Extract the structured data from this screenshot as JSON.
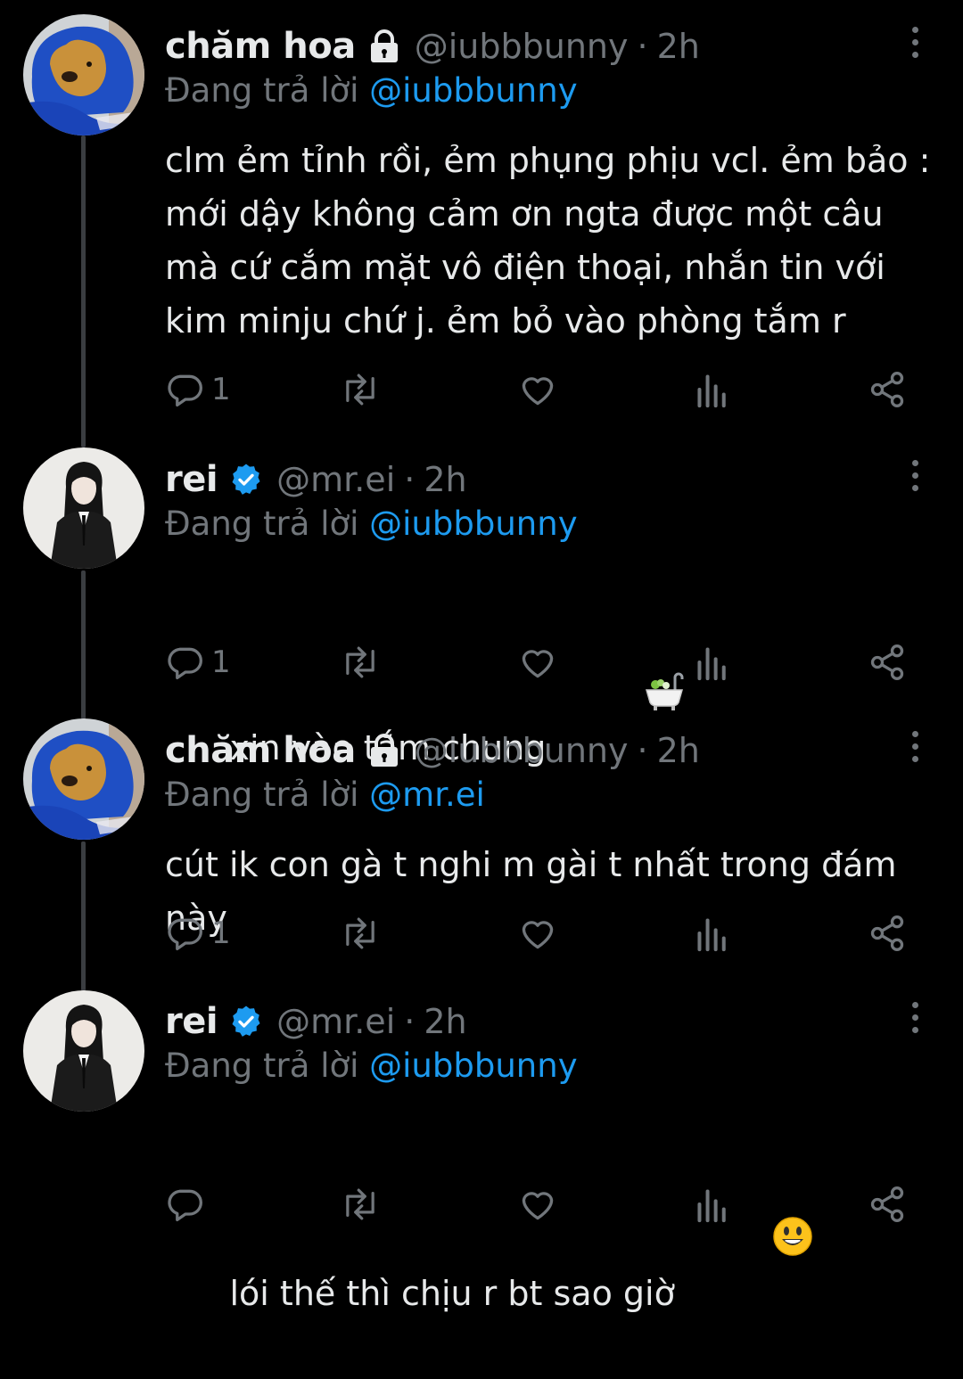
{
  "colors": {
    "background": "#000000",
    "text": "#e7e9ea",
    "muted": "#71767b",
    "accent": "#1d9bf0",
    "thread_line": "#3a3d41"
  },
  "tweets": [
    {
      "display_name": "chăm hoa",
      "badge": "lock-icon",
      "handle": "@iubbbunny",
      "separator": "·",
      "time": "2h",
      "reply_prefix": "Đang trả lời ",
      "reply_to": "@iubbbunny",
      "text": "clm ẻm tỉnh rồi, ẻm phụng phịu vcl. ẻm bảo : mới dậy không cảm ơn ngta được một câu mà cứ cắm mặt vô điện thoại, nhắn tin với kim minju chứ j. ẻm bỏ vào phòng tắm r",
      "emoji": "",
      "reply_count": "1",
      "avatar": "dog-in-blue-hoodie-avatar"
    },
    {
      "display_name": "rei",
      "badge": "verified-icon",
      "handle": "@mr.ei",
      "separator": "·",
      "time": "2h",
      "reply_prefix": "Đang trả lời ",
      "reply_to": "@iubbbunny",
      "text": "xin vào tắm chung ",
      "emoji": "bathtub-emoji",
      "reply_count": "1",
      "avatar": "girl-in-black-suit-avatar"
    },
    {
      "display_name": "chăm hoa",
      "badge": "lock-icon",
      "handle": "@iubbbunny",
      "separator": "·",
      "time": "2h",
      "reply_prefix": "Đang trả lời ",
      "reply_to": "@mr.ei",
      "text": "cút ik con gà t nghi m gài t nhất trong đám này",
      "emoji": "",
      "reply_count": "1",
      "avatar": "dog-in-blue-hoodie-avatar"
    },
    {
      "display_name": "rei",
      "badge": "verified-icon",
      "handle": "@mr.ei",
      "separator": "·",
      "time": "2h",
      "reply_prefix": "Đang trả lời ",
      "reply_to": "@iubbbunny",
      "text": "lói thế thì chịu r bt sao giờ ",
      "emoji": "smiley-emoji",
      "reply_count": "",
      "avatar": "girl-in-black-suit-avatar"
    }
  ],
  "action_icons": [
    "reply-icon",
    "retweet-icon",
    "like-icon",
    "views-icon",
    "share-icon"
  ]
}
